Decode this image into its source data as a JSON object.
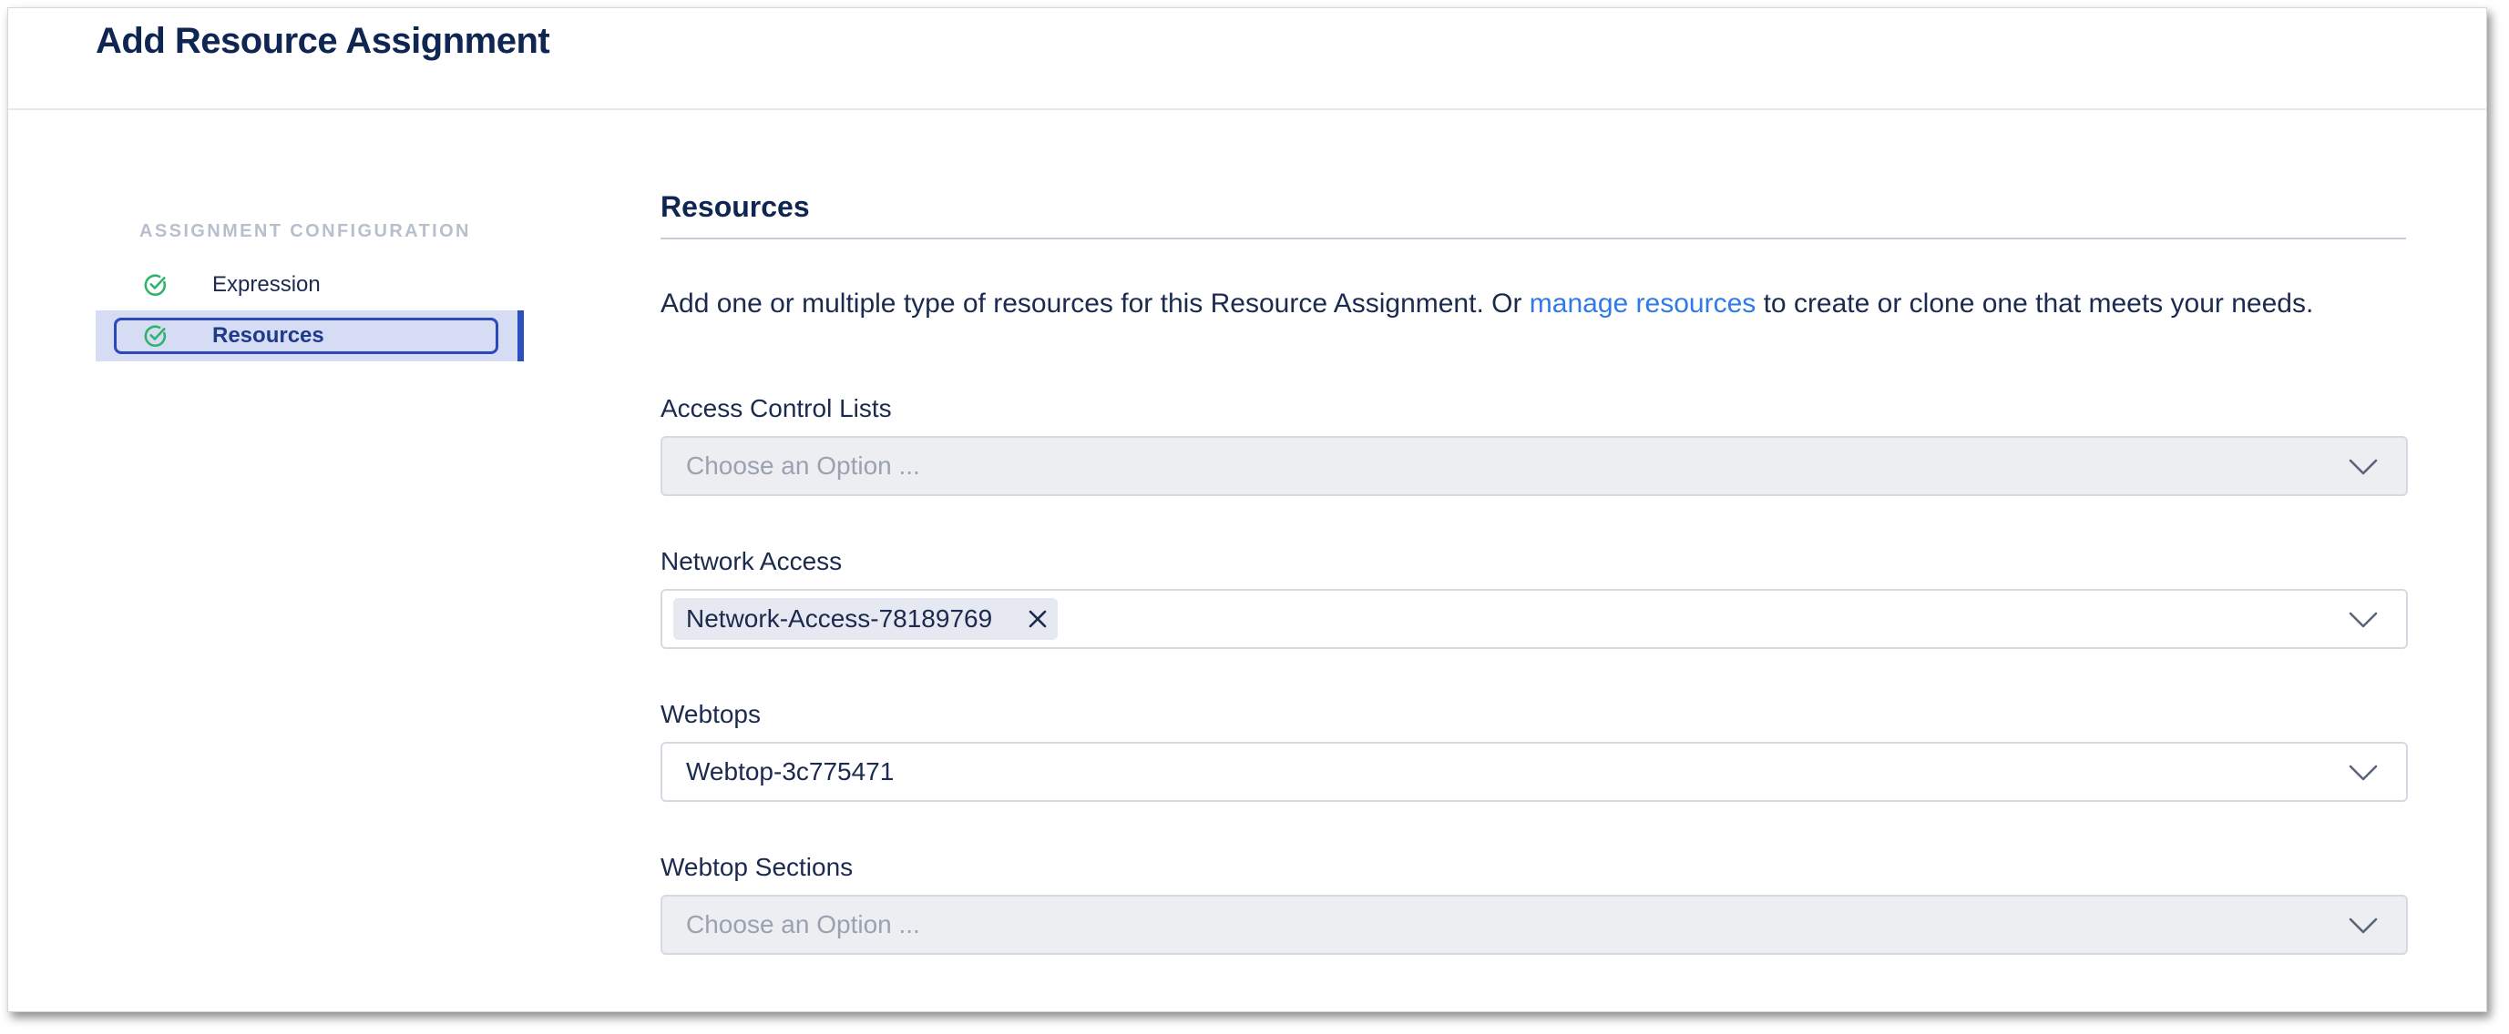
{
  "page": {
    "title": "Add Resource Assignment"
  },
  "sidebar": {
    "heading": "ASSIGNMENT CONFIGURATION",
    "items": [
      {
        "label": "Expression",
        "icon": "check-circle-icon",
        "status": "complete"
      },
      {
        "label": "Resources",
        "icon": "check-circle-icon",
        "status": "complete",
        "active": true
      }
    ]
  },
  "main": {
    "section_title": "Resources",
    "description": {
      "before": "Add one or multiple type of resources for this Resource Assignment. Or ",
      "link": "manage resources",
      "after": " to create or clone one that meets your needs."
    },
    "fields": {
      "acl": {
        "label": "Access Control Lists",
        "placeholder": "Choose an Option ...",
        "disabled": true
      },
      "network_access": {
        "label": "Network Access",
        "chips": [
          "Network-Access-78189769"
        ]
      },
      "webtops": {
        "label": "Webtops",
        "value": "Webtop-3c775471"
      },
      "webtop_sections": {
        "label": "Webtop Sections",
        "placeholder": "Choose an Option ...",
        "disabled": true
      }
    }
  },
  "colors": {
    "title": "#0f2552",
    "link": "#2f7ae8",
    "success": "#2fb36a",
    "active_bg": "#d6dcf3",
    "active_accent": "#2c4fc0",
    "disabled_bg": "#eceef2"
  }
}
